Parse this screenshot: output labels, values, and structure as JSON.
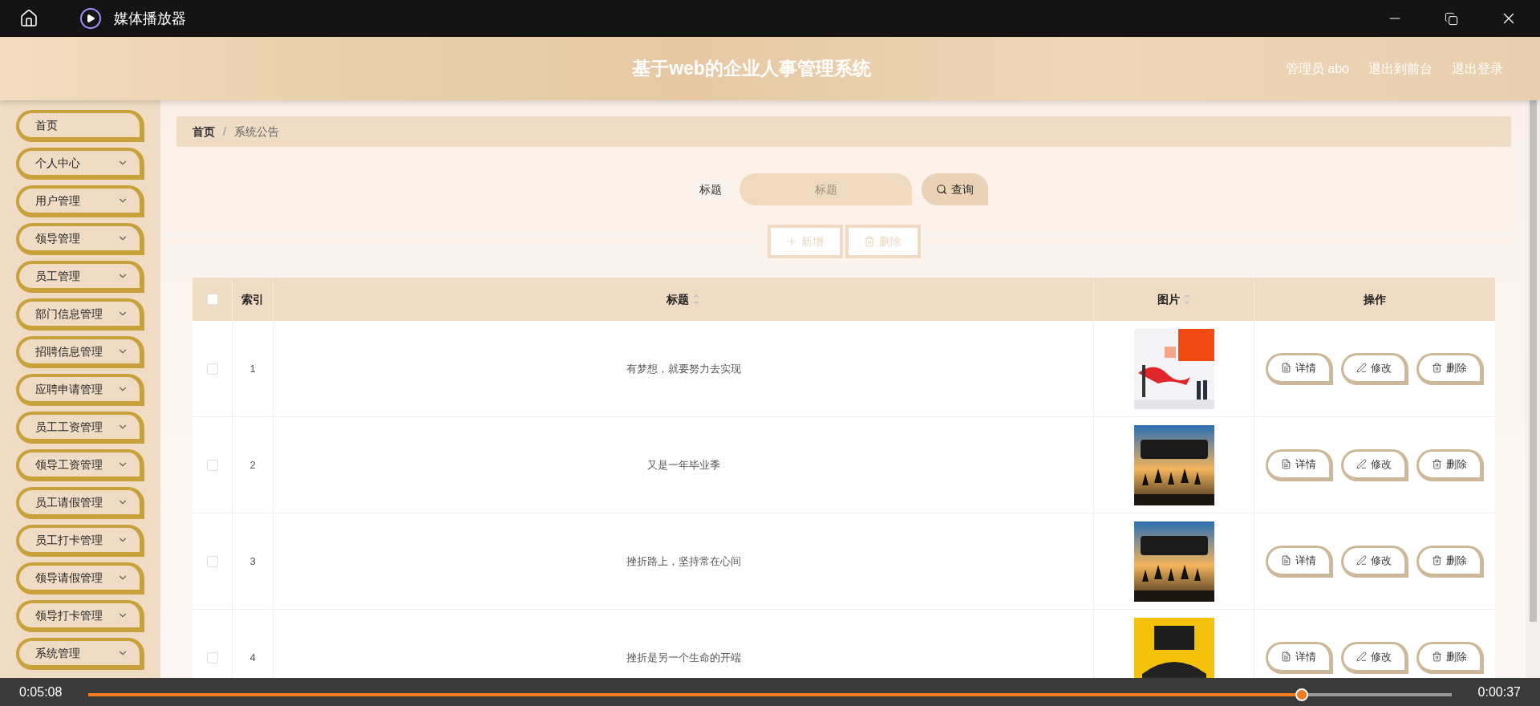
{
  "window": {
    "title": "媒体播放器"
  },
  "header": {
    "title": "基于web的企业人事管理系统",
    "links": [
      "管理员 abo",
      "退出到前台",
      "退出登录"
    ]
  },
  "sidebar": {
    "items": [
      {
        "label": "首页",
        "expandable": false
      },
      {
        "label": "个人中心",
        "expandable": true
      },
      {
        "label": "用户管理",
        "expandable": true
      },
      {
        "label": "领导管理",
        "expandable": true
      },
      {
        "label": "员工管理",
        "expandable": true
      },
      {
        "label": "部门信息管理",
        "expandable": true
      },
      {
        "label": "招聘信息管理",
        "expandable": true
      },
      {
        "label": "应聘申请管理",
        "expandable": true
      },
      {
        "label": "员工工资管理",
        "expandable": true
      },
      {
        "label": "领导工资管理",
        "expandable": true
      },
      {
        "label": "员工请假管理",
        "expandable": true
      },
      {
        "label": "员工打卡管理",
        "expandable": true
      },
      {
        "label": "领导请假管理",
        "expandable": true
      },
      {
        "label": "领导打卡管理",
        "expandable": true
      },
      {
        "label": "系统管理",
        "expandable": true
      }
    ]
  },
  "breadcrumb": {
    "separator": "/",
    "items": [
      "首页",
      "系统公告"
    ]
  },
  "search": {
    "label": "标题",
    "placeholder": "标题",
    "button": "查询"
  },
  "actions": [
    {
      "kind": "add",
      "label": "新增",
      "disabled": true
    },
    {
      "kind": "delete",
      "label": "删除",
      "disabled": true
    }
  ],
  "table": {
    "select_all": {
      "checked": false
    },
    "columns": [
      {
        "label": "索引",
        "sortable": false
      },
      {
        "label": "标题",
        "sortable": true
      },
      {
        "label": "图片",
        "sortable": true
      },
      {
        "label": "操作",
        "sortable": false
      }
    ],
    "rows": [
      {
        "checked": false,
        "index": "1",
        "title": "有梦想，就要努力去实现",
        "actions": [
          {
            "kind": "detail",
            "label": "详情"
          },
          {
            "kind": "edit",
            "label": "修改"
          },
          {
            "kind": "delete",
            "label": "删除"
          }
        ]
      },
      {
        "checked": false,
        "index": "2",
        "title": "又是一年毕业季",
        "actions": [
          {
            "kind": "detail",
            "label": "详情"
          },
          {
            "kind": "edit",
            "label": "修改"
          },
          {
            "kind": "delete",
            "label": "删除"
          }
        ]
      },
      {
        "checked": false,
        "index": "3",
        "title": "挫折路上，坚持常在心间",
        "actions": [
          {
            "kind": "detail",
            "label": "详情"
          },
          {
            "kind": "edit",
            "label": "修改"
          },
          {
            "kind": "delete",
            "label": "删除"
          }
        ]
      },
      {
        "checked": false,
        "index": "4",
        "title": "挫折是另一个生命的开端",
        "actions": [
          {
            "kind": "detail",
            "label": "详情"
          },
          {
            "kind": "edit",
            "label": "修改"
          },
          {
            "kind": "delete",
            "label": "删除"
          }
        ]
      }
    ]
  },
  "player": {
    "elapsed": "0:05:08",
    "remaining": "0:00:37",
    "level": 0.89
  }
}
